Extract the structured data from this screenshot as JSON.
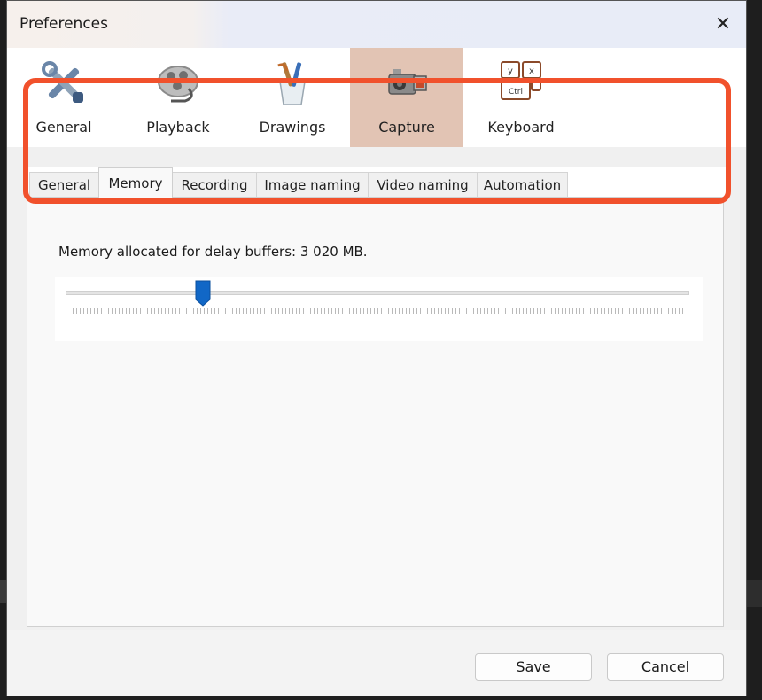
{
  "window": {
    "title": "Preferences",
    "close_glyph": "✕"
  },
  "toolbar": {
    "items": [
      {
        "label": "General",
        "icon": "tools-icon"
      },
      {
        "label": "Playback",
        "icon": "film-reel-icon"
      },
      {
        "label": "Drawings",
        "icon": "brushes-icon"
      },
      {
        "label": "Capture",
        "icon": "camcorder-icon",
        "active": true
      },
      {
        "label": "Keyboard",
        "icon": "keyboard-keys-icon"
      }
    ]
  },
  "tabs": [
    {
      "label": "General"
    },
    {
      "label": "Memory",
      "active": true
    },
    {
      "label": "Recording"
    },
    {
      "label": "Image naming"
    },
    {
      "label": "Video naming"
    },
    {
      "label": "Automation"
    }
  ],
  "memory": {
    "label": "Memory allocated for delay buffers: 3 020 MB.",
    "slider_fraction": 0.22
  },
  "footer": {
    "save_label": "Save",
    "cancel_label": "Cancel"
  },
  "colors": {
    "active_tool_bg": "#e2c4b4",
    "highlight": "#f1512c",
    "slider_thumb": "#1167c6"
  }
}
